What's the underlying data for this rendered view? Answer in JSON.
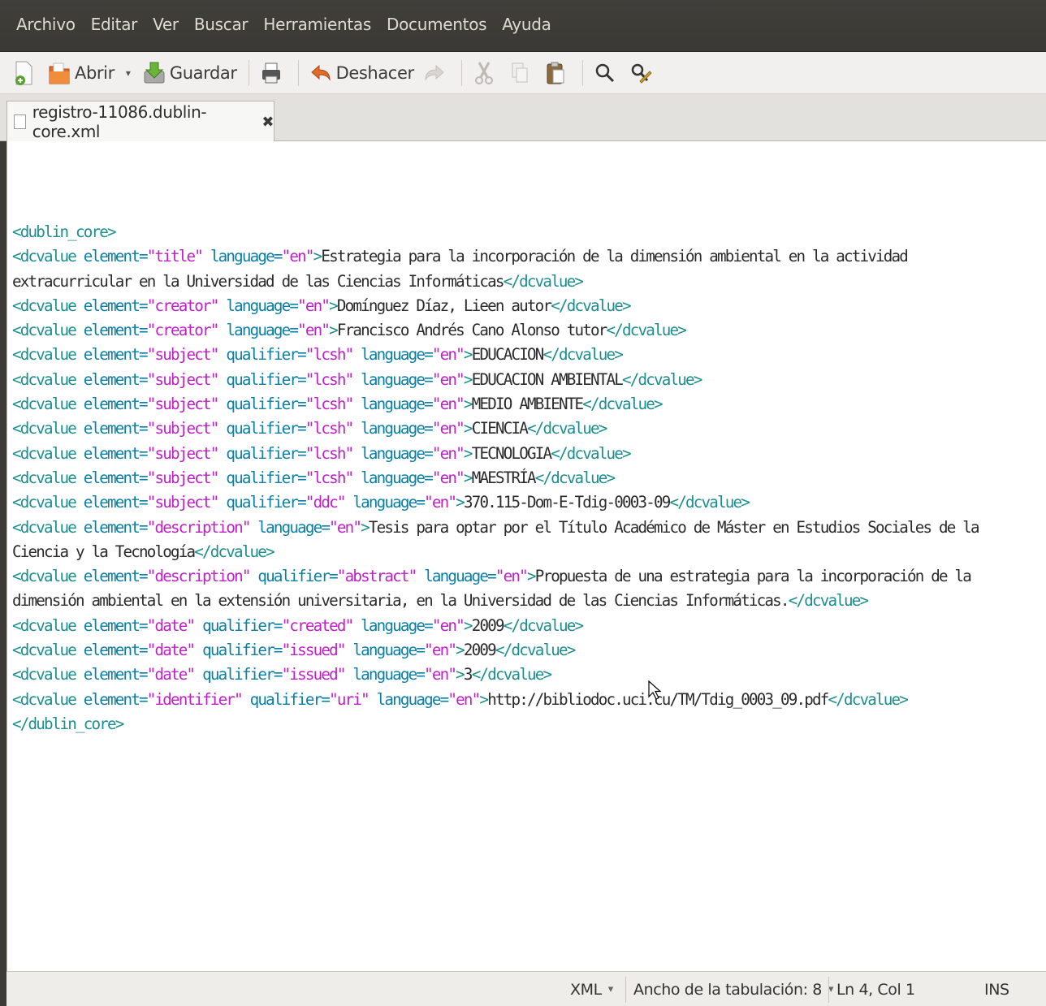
{
  "menubar": {
    "items": [
      "Archivo",
      "Editar",
      "Ver",
      "Buscar",
      "Herramientas",
      "Documentos",
      "Ayuda"
    ]
  },
  "toolbar": {
    "new_icon": "new-document-icon",
    "open_label": "Abrir",
    "save_label": "Guardar",
    "undo_label": "Deshacer"
  },
  "tab": {
    "filename": "registro-11086.dublin-core.xml",
    "close_glyph": "✖"
  },
  "code_lines": [
    [
      {
        "t": "tag",
        "v": "<dublin_core>"
      }
    ],
    [
      {
        "t": "tag",
        "v": "<dcvalue "
      },
      {
        "t": "attr",
        "v": "element="
      },
      {
        "t": "val",
        "v": "\"title\""
      },
      {
        "t": "attr",
        "v": " language="
      },
      {
        "t": "val",
        "v": "\"en\""
      },
      {
        "t": "tag",
        "v": ">"
      },
      {
        "t": "txt",
        "v": "Estrategia para la incorporación de la dimensión ambiental en la actividad"
      }
    ],
    [
      {
        "t": "txt",
        "v": "extracurricular en la Universidad de las Ciencias Informáticas"
      },
      {
        "t": "tag",
        "v": "</dcvalue>"
      }
    ],
    [
      {
        "t": "tag",
        "v": "<dcvalue "
      },
      {
        "t": "attr",
        "v": "element="
      },
      {
        "t": "val",
        "v": "\"creator\""
      },
      {
        "t": "attr",
        "v": " language="
      },
      {
        "t": "val",
        "v": "\"en\""
      },
      {
        "t": "tag",
        "v": ">"
      },
      {
        "t": "txt",
        "v": "Domínguez Díaz, Lieen autor"
      },
      {
        "t": "tag",
        "v": "</dcvalue>"
      }
    ],
    [
      {
        "t": "tag",
        "v": "<dcvalue "
      },
      {
        "t": "attr",
        "v": "element="
      },
      {
        "t": "val",
        "v": "\"creator\""
      },
      {
        "t": "attr",
        "v": " language="
      },
      {
        "t": "val",
        "v": "\"en\""
      },
      {
        "t": "tag",
        "v": ">"
      },
      {
        "t": "txt",
        "v": "Francisco Andrés Cano Alonso tutor"
      },
      {
        "t": "tag",
        "v": "</dcvalue>"
      }
    ],
    [
      {
        "t": "tag",
        "v": "<dcvalue "
      },
      {
        "t": "attr",
        "v": "element="
      },
      {
        "t": "val",
        "v": "\"subject\""
      },
      {
        "t": "attr",
        "v": " qualifier="
      },
      {
        "t": "val",
        "v": "\"lcsh\""
      },
      {
        "t": "attr",
        "v": " language="
      },
      {
        "t": "val",
        "v": "\"en\""
      },
      {
        "t": "tag",
        "v": ">"
      },
      {
        "t": "txt",
        "v": "EDUCACION"
      },
      {
        "t": "tag",
        "v": "</dcvalue>"
      }
    ],
    [
      {
        "t": "tag",
        "v": "<dcvalue "
      },
      {
        "t": "attr",
        "v": "element="
      },
      {
        "t": "val",
        "v": "\"subject\""
      },
      {
        "t": "attr",
        "v": " qualifier="
      },
      {
        "t": "val",
        "v": "\"lcsh\""
      },
      {
        "t": "attr",
        "v": " language="
      },
      {
        "t": "val",
        "v": "\"en\""
      },
      {
        "t": "tag",
        "v": ">"
      },
      {
        "t": "txt",
        "v": "EDUCACION AMBIENTAL"
      },
      {
        "t": "tag",
        "v": "</dcvalue>"
      }
    ],
    [
      {
        "t": "tag",
        "v": "<dcvalue "
      },
      {
        "t": "attr",
        "v": "element="
      },
      {
        "t": "val",
        "v": "\"subject\""
      },
      {
        "t": "attr",
        "v": " qualifier="
      },
      {
        "t": "val",
        "v": "\"lcsh\""
      },
      {
        "t": "attr",
        "v": " language="
      },
      {
        "t": "val",
        "v": "\"en\""
      },
      {
        "t": "tag",
        "v": ">"
      },
      {
        "t": "txt",
        "v": "MEDIO AMBIENTE"
      },
      {
        "t": "tag",
        "v": "</dcvalue>"
      }
    ],
    [
      {
        "t": "tag",
        "v": "<dcvalue "
      },
      {
        "t": "attr",
        "v": "element="
      },
      {
        "t": "val",
        "v": "\"subject\""
      },
      {
        "t": "attr",
        "v": " qualifier="
      },
      {
        "t": "val",
        "v": "\"lcsh\""
      },
      {
        "t": "attr",
        "v": " language="
      },
      {
        "t": "val",
        "v": "\"en\""
      },
      {
        "t": "tag",
        "v": ">"
      },
      {
        "t": "txt",
        "v": "CIENCIA"
      },
      {
        "t": "tag",
        "v": "</dcvalue>"
      }
    ],
    [
      {
        "t": "tag",
        "v": "<dcvalue "
      },
      {
        "t": "attr",
        "v": "element="
      },
      {
        "t": "val",
        "v": "\"subject\""
      },
      {
        "t": "attr",
        "v": " qualifier="
      },
      {
        "t": "val",
        "v": "\"lcsh\""
      },
      {
        "t": "attr",
        "v": " language="
      },
      {
        "t": "val",
        "v": "\"en\""
      },
      {
        "t": "tag",
        "v": ">"
      },
      {
        "t": "txt",
        "v": "TECNOLOGIA"
      },
      {
        "t": "tag",
        "v": "</dcvalue>"
      }
    ],
    [
      {
        "t": "tag",
        "v": "<dcvalue "
      },
      {
        "t": "attr",
        "v": "element="
      },
      {
        "t": "val",
        "v": "\"subject\""
      },
      {
        "t": "attr",
        "v": " qualifier="
      },
      {
        "t": "val",
        "v": "\"lcsh\""
      },
      {
        "t": "attr",
        "v": " language="
      },
      {
        "t": "val",
        "v": "\"en\""
      },
      {
        "t": "tag",
        "v": ">"
      },
      {
        "t": "txt",
        "v": "MAESTRÍA"
      },
      {
        "t": "tag",
        "v": "</dcvalue>"
      }
    ],
    [
      {
        "t": "tag",
        "v": "<dcvalue "
      },
      {
        "t": "attr",
        "v": "element="
      },
      {
        "t": "val",
        "v": "\"subject\""
      },
      {
        "t": "attr",
        "v": " qualifier="
      },
      {
        "t": "val",
        "v": "\"ddc\""
      },
      {
        "t": "attr",
        "v": " language="
      },
      {
        "t": "val",
        "v": "\"en\""
      },
      {
        "t": "tag",
        "v": ">"
      },
      {
        "t": "txt",
        "v": "370.115-Dom-E-Tdig-0003-09"
      },
      {
        "t": "tag",
        "v": "</dcvalue>"
      }
    ],
    [
      {
        "t": "tag",
        "v": "<dcvalue "
      },
      {
        "t": "attr",
        "v": "element="
      },
      {
        "t": "val",
        "v": "\"description\""
      },
      {
        "t": "attr",
        "v": " language="
      },
      {
        "t": "val",
        "v": "\"en\""
      },
      {
        "t": "tag",
        "v": ">"
      },
      {
        "t": "txt",
        "v": "Tesis para optar por el Título Académico de Máster en Estudios Sociales de la"
      }
    ],
    [
      {
        "t": "txt",
        "v": "Ciencia y la Tecnología"
      },
      {
        "t": "tag",
        "v": "</dcvalue>"
      }
    ],
    [
      {
        "t": "tag",
        "v": "<dcvalue "
      },
      {
        "t": "attr",
        "v": "element="
      },
      {
        "t": "val",
        "v": "\"description\""
      },
      {
        "t": "attr",
        "v": " qualifier="
      },
      {
        "t": "val",
        "v": "\"abstract\""
      },
      {
        "t": "attr",
        "v": " language="
      },
      {
        "t": "val",
        "v": "\"en\""
      },
      {
        "t": "tag",
        "v": ">"
      },
      {
        "t": "txt",
        "v": "Propuesta de una estrategia para la incorporación de la"
      }
    ],
    [
      {
        "t": "txt",
        "v": "dimensión ambiental en la extensión universitaria, en la Universidad de las Ciencias Informáticas."
      },
      {
        "t": "tag",
        "v": "</dcvalue>"
      }
    ],
    [
      {
        "t": "tag",
        "v": "<dcvalue "
      },
      {
        "t": "attr",
        "v": "element="
      },
      {
        "t": "val",
        "v": "\"date\""
      },
      {
        "t": "attr",
        "v": " qualifier="
      },
      {
        "t": "val",
        "v": "\"created\""
      },
      {
        "t": "attr",
        "v": " language="
      },
      {
        "t": "val",
        "v": "\"en\""
      },
      {
        "t": "tag",
        "v": ">"
      },
      {
        "t": "txt",
        "v": "2009"
      },
      {
        "t": "tag",
        "v": "</dcvalue>"
      }
    ],
    [
      {
        "t": "tag",
        "v": "<dcvalue "
      },
      {
        "t": "attr",
        "v": "element="
      },
      {
        "t": "val",
        "v": "\"date\""
      },
      {
        "t": "attr",
        "v": " qualifier="
      },
      {
        "t": "val",
        "v": "\"issued\""
      },
      {
        "t": "attr",
        "v": " language="
      },
      {
        "t": "val",
        "v": "\"en\""
      },
      {
        "t": "tag",
        "v": ">"
      },
      {
        "t": "txt",
        "v": "2009"
      },
      {
        "t": "tag",
        "v": "</dcvalue>"
      }
    ],
    [
      {
        "t": "tag",
        "v": "<dcvalue "
      },
      {
        "t": "attr",
        "v": "element="
      },
      {
        "t": "val",
        "v": "\"date\""
      },
      {
        "t": "attr",
        "v": " qualifier="
      },
      {
        "t": "val",
        "v": "\"issued\""
      },
      {
        "t": "attr",
        "v": " language="
      },
      {
        "t": "val",
        "v": "\"en\""
      },
      {
        "t": "tag",
        "v": ">"
      },
      {
        "t": "txt",
        "v": "3"
      },
      {
        "t": "tag",
        "v": "</dcvalue>"
      }
    ],
    [
      {
        "t": "tag",
        "v": "<dcvalue "
      },
      {
        "t": "attr",
        "v": "element="
      },
      {
        "t": "val",
        "v": "\"identifier\""
      },
      {
        "t": "attr",
        "v": " qualifier="
      },
      {
        "t": "val",
        "v": "\"uri\""
      },
      {
        "t": "attr",
        "v": " language="
      },
      {
        "t": "val",
        "v": "\"en\""
      },
      {
        "t": "tag",
        "v": ">"
      },
      {
        "t": "txt",
        "v": "http://bibliodoc.uci.cu/TM/Tdig_0003_09.pdf"
      },
      {
        "t": "tag",
        "v": "</dcvalue>"
      }
    ],
    [
      {
        "t": "tag",
        "v": "</dublin_core>"
      }
    ]
  ],
  "statusbar": {
    "language": "XML",
    "tab_width": "Ancho de la tabulación: 8",
    "dropdown_glyph": "▾",
    "position": "Ln 4, Col 1",
    "mode": "INS"
  },
  "colors": {
    "tag": "#1c8e8e",
    "attribute": "#0a7fa6",
    "string": "#c020c8",
    "text": "#2a2a2a"
  }
}
